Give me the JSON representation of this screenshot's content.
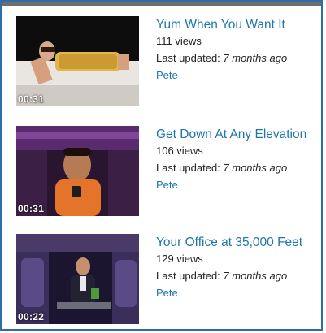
{
  "videos": [
    {
      "title": "Yum When You Want It",
      "views": "111 views",
      "updated_label": "Last updated: ",
      "updated_ago": "7 months ago",
      "author": "Pete",
      "duration": "00:31"
    },
    {
      "title": "Get Down At Any Elevation",
      "views": "106 views",
      "updated_label": "Last updated: ",
      "updated_ago": "7 months ago",
      "author": "Pete",
      "duration": "00:31"
    },
    {
      "title": "Your Office at 35,000 Feet",
      "views": "129 views",
      "updated_label": "Last updated: ",
      "updated_ago": "7 months ago",
      "author": "Pete",
      "duration": "00:22"
    }
  ],
  "colors": {
    "link": "#1f76ad",
    "border": "#2c6fa8",
    "text": "#222222"
  }
}
